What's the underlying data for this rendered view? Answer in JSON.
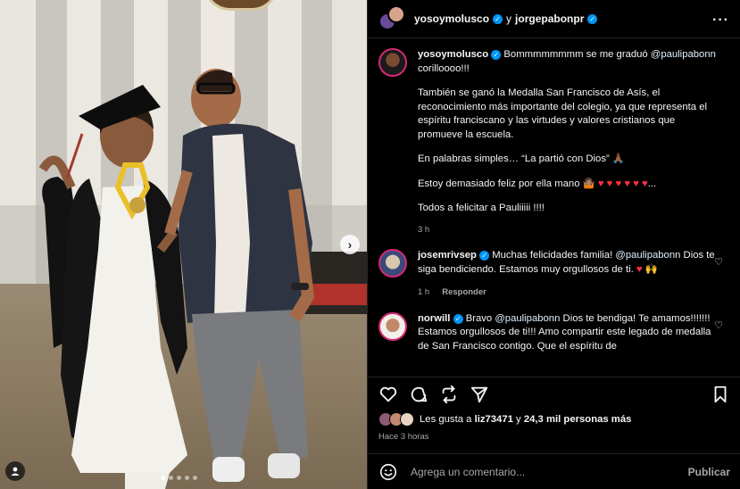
{
  "header": {
    "author": "yosoymolusco",
    "connector": "y",
    "coauthor": "jorgepabonpr",
    "more_icon": "more-horizontal-icon"
  },
  "caption": {
    "author": "yosoymolusco",
    "line1_text": "Bommmmmmmm se me graduó",
    "line1_mention": "@paulipabonn",
    "line1_tail": "corilloooo!!!",
    "p2": "También se ganó la Medalla San Francisco de Asís, el reconocimiento más importante del colegio, ya que representa el espíritu franciscano y las virtudes y valores cristianos que promueve la escuela.",
    "p3": "En palabras simples… “La partió con Dios” 🙏🏾",
    "p4_text": "Estoy demasiado feliz por ella mano 🤷🏽",
    "p4_hearts": "♥ ♥ ♥ ♥ ♥ ♥",
    "p4_tail": "...",
    "p5": "Todos a felicitar a Pauliiiii !!!!",
    "time": "3 h"
  },
  "comments": [
    {
      "user": "josemrivsep",
      "text_before": "Muchas felicidades familia!",
      "mention": "@paulipabonn",
      "text_after": "Dios te siga bendiciendo. Estamos muy orgullosos de ti.",
      "emoji": "♥ 🙌",
      "time": "1 h",
      "reply": "Responder"
    },
    {
      "user": "norwill",
      "text_before": "Bravo",
      "mention": "@paulipabonn",
      "text_after": "Dios te bendiga! Te amamos!!!!!!! Estamos orgullosos de ti!!! Amo compartir este legado de medalla de San Francisco contigo. Que el espíritu de"
    }
  ],
  "likes": {
    "prefix": "Les gusta a",
    "user": "liz73471",
    "middle": "y",
    "count": "24,3 mil personas más"
  },
  "posted": "Hace 3 horas",
  "composer": {
    "placeholder": "Agrega un comentario...",
    "publish": "Publicar"
  },
  "carousel": {
    "slides": 5,
    "active": 1
  },
  "colors": {
    "verified": "#0095f6",
    "heart": "#ff3040",
    "background": "#000000",
    "muted": "#a8a8a8"
  }
}
